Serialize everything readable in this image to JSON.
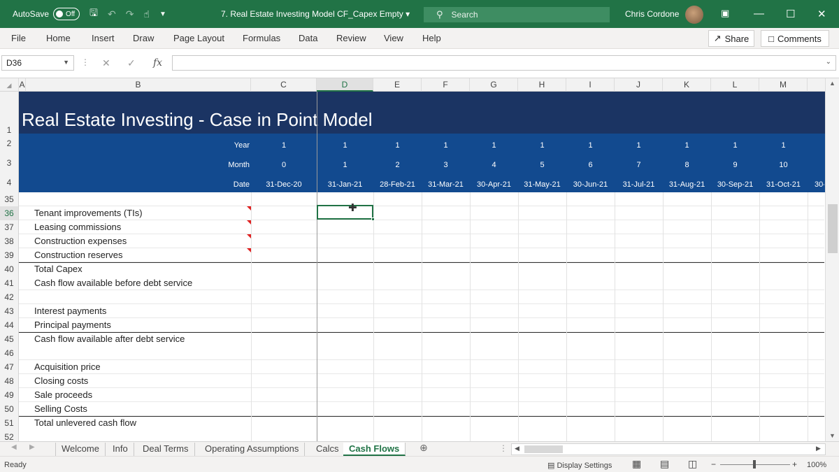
{
  "titlebar": {
    "autosave_label": "AutoSave",
    "autosave_state": "Off",
    "doc_title": "7. Real Estate Investing Model CF_Capex Empty",
    "search_placeholder": "Search",
    "user_name": "Chris Cordone"
  },
  "menu": [
    "File",
    "Home",
    "Insert",
    "Draw",
    "Page Layout",
    "Formulas",
    "Data",
    "Review",
    "View",
    "Help"
  ],
  "actions": {
    "share": "Share",
    "comments": "Comments"
  },
  "formula_bar": {
    "name_box": "D36",
    "fx": "fx",
    "formula": ""
  },
  "columns": [
    "A",
    "B",
    "C",
    "D",
    "E",
    "F",
    "G",
    "H",
    "I",
    "J",
    "K",
    "L",
    "M"
  ],
  "selected_cell": "D36",
  "sheet": {
    "title": "Real Estate Investing - Case in Point Model",
    "header_rows": {
      "row_numbers": [
        "1",
        "2",
        "3",
        "4"
      ],
      "year_label": "Year",
      "month_label": "Month",
      "date_label": "Date",
      "years": [
        "1",
        "1",
        "1",
        "1",
        "1",
        "1",
        "1",
        "1",
        "1",
        "1",
        "1"
      ],
      "months": [
        "0",
        "1",
        "2",
        "3",
        "4",
        "5",
        "6",
        "7",
        "8",
        "9",
        "10"
      ],
      "dates": [
        "31-Dec-20",
        "31-Jan-21",
        "28-Feb-21",
        "31-Mar-21",
        "30-Apr-21",
        "31-May-21",
        "30-Jun-21",
        "31-Jul-21",
        "31-Aug-21",
        "30-Sep-21",
        "31-Oct-21",
        "30-"
      ]
    },
    "rows": [
      {
        "num": "35",
        "label": ""
      },
      {
        "num": "36",
        "label": "Tenant improvements (TIs)"
      },
      {
        "num": "37",
        "label": "Leasing commissions"
      },
      {
        "num": "38",
        "label": "Construction expenses"
      },
      {
        "num": "39",
        "label": "Construction reserves"
      },
      {
        "num": "40",
        "label": "Total Capex"
      },
      {
        "num": "41",
        "label": "Cash flow available before debt service"
      },
      {
        "num": "42",
        "label": ""
      },
      {
        "num": "43",
        "label": "Interest payments"
      },
      {
        "num": "44",
        "label": "Principal payments"
      },
      {
        "num": "45",
        "label": "Cash flow available after debt service"
      },
      {
        "num": "46",
        "label": ""
      },
      {
        "num": "47",
        "label": "Acquisition price"
      },
      {
        "num": "48",
        "label": "Closing costs"
      },
      {
        "num": "49",
        "label": "Sale proceeds"
      },
      {
        "num": "50",
        "label": "Selling Costs"
      },
      {
        "num": "51",
        "label": "Total unlevered cash flow"
      },
      {
        "num": "52",
        "label": ""
      }
    ]
  },
  "tabs": [
    "Welcome",
    "Info",
    "Deal Terms",
    "Operating Assumptions",
    "Calcs",
    "Cash Flows"
  ],
  "active_tab": "Cash Flows",
  "status": {
    "ready": "Ready",
    "display_settings": "Display Settings",
    "zoom": "100%",
    "zoom_minus": "−",
    "zoom_plus": "+"
  },
  "colors": {
    "excel_green": "#217346",
    "title_banner": "#1b3463",
    "header_banner": "#124a8f"
  }
}
